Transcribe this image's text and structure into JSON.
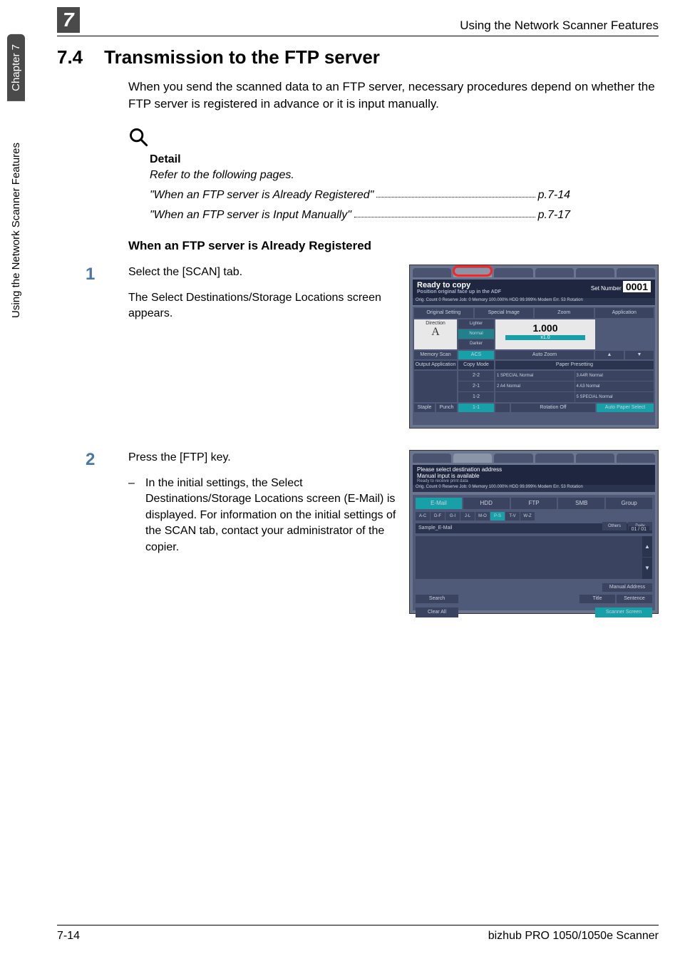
{
  "sidebar": {
    "chapter": "Chapter 7",
    "feature": "Using the Network Scanner Features"
  },
  "header": {
    "chapter_num": "7",
    "running_head": "Using the Network Scanner Features"
  },
  "section": {
    "number": "7.4",
    "title": "Transmission to the FTP server"
  },
  "intro_para": "When you send the scanned data to an FTP server, necessary procedures depend on whether the FTP server is registered in advance or it is input manually.",
  "detail": {
    "head": "Detail",
    "body": "Refer to the following pages.",
    "refs": [
      {
        "text": "\"When an FTP server is Already Registered\"",
        "page": "p.7-14"
      },
      {
        "text": "\"When an FTP server is Input Manually\"",
        "page": "p.7-17"
      }
    ]
  },
  "subhead": "When an FTP server is Already Registered",
  "steps": [
    {
      "num": "1",
      "lines": [
        "Select the [SCAN] tab.",
        "The Select Destinations/Storage Locations screen appears."
      ],
      "bullets": []
    },
    {
      "num": "2",
      "lines": [
        "Press the [FTP] key."
      ],
      "bullets": [
        "In the initial settings, the Select Destinations/Storage Locations screen (E-Mail) is displayed. For information on the initial settings of the SCAN tab, contact your administrator of the copier."
      ]
    }
  ],
  "shot1": {
    "status_main": "Ready to copy",
    "status_sub1": "Position original face up in the ADF",
    "status_sub2": "Ready to receive print data",
    "set_label": "Set Number",
    "set_num": "0001",
    "meta_left": "Orig. Count       0 Reserve Job:     0 Memory 100.000% HDD    99.999% Modem Err. 53 Rotation",
    "header_btns": [
      "Original Setting",
      "Special Image",
      "Zoom",
      "Application"
    ],
    "direction_label": "Direction",
    "direction_letter": "A",
    "density": [
      "Lighter",
      "Normal",
      "Darker"
    ],
    "zoom_val": "1.000",
    "zoom_x1": "x1.0",
    "second_row": {
      "memscan": "Memory Scan",
      "acs": "ACS",
      "autozoom": "Auto Zoom"
    },
    "third_bar": {
      "oa": "Output Application",
      "cm": "Copy Mode",
      "pp": "Paper Presetting"
    },
    "mode_list": [
      "2-2",
      "2-1",
      "1-2"
    ],
    "papers": [
      "1 SPECIAL Normal",
      "3 A4R Normal",
      "2 A4 Normal",
      "4 A3 Normal",
      "",
      "5 SPECIAL Normal"
    ],
    "bottom": {
      "staple": "Staple",
      "punch": "Punch",
      "oneone": "1-1",
      "rotate": "Rotation Off",
      "autopaper": "Auto Paper Select"
    }
  },
  "shot2": {
    "status_line1": "Please select destination address",
    "status_line2": "Manual input is available",
    "status_line3": "Ready to receive print data",
    "meta": "Orig. Count       0 Reserve Job:     0 Memory 100.000% HDD    99.999% Modem Err. 53 Rotation",
    "protocols": [
      "E-Mail",
      "HDD",
      "FTP",
      "SMB",
      "Group"
    ],
    "alphas": [
      "A-C",
      "D-F",
      "G-I",
      "J-L",
      "M-O",
      "P-S",
      "T-V",
      "W-Z"
    ],
    "right_btns": [
      "Others",
      "Daily"
    ],
    "entry": "Sample_E-Mail",
    "page_count": "01 / 01",
    "manual": "Manual Address",
    "search": "Search",
    "title_btn": "Title",
    "sentence_btn": "Sentence",
    "clear": "Clear All",
    "scanner_screen": "Scanner Screen"
  },
  "footer": {
    "left": "7-14",
    "right": "bizhub PRO 1050/1050e Scanner"
  }
}
